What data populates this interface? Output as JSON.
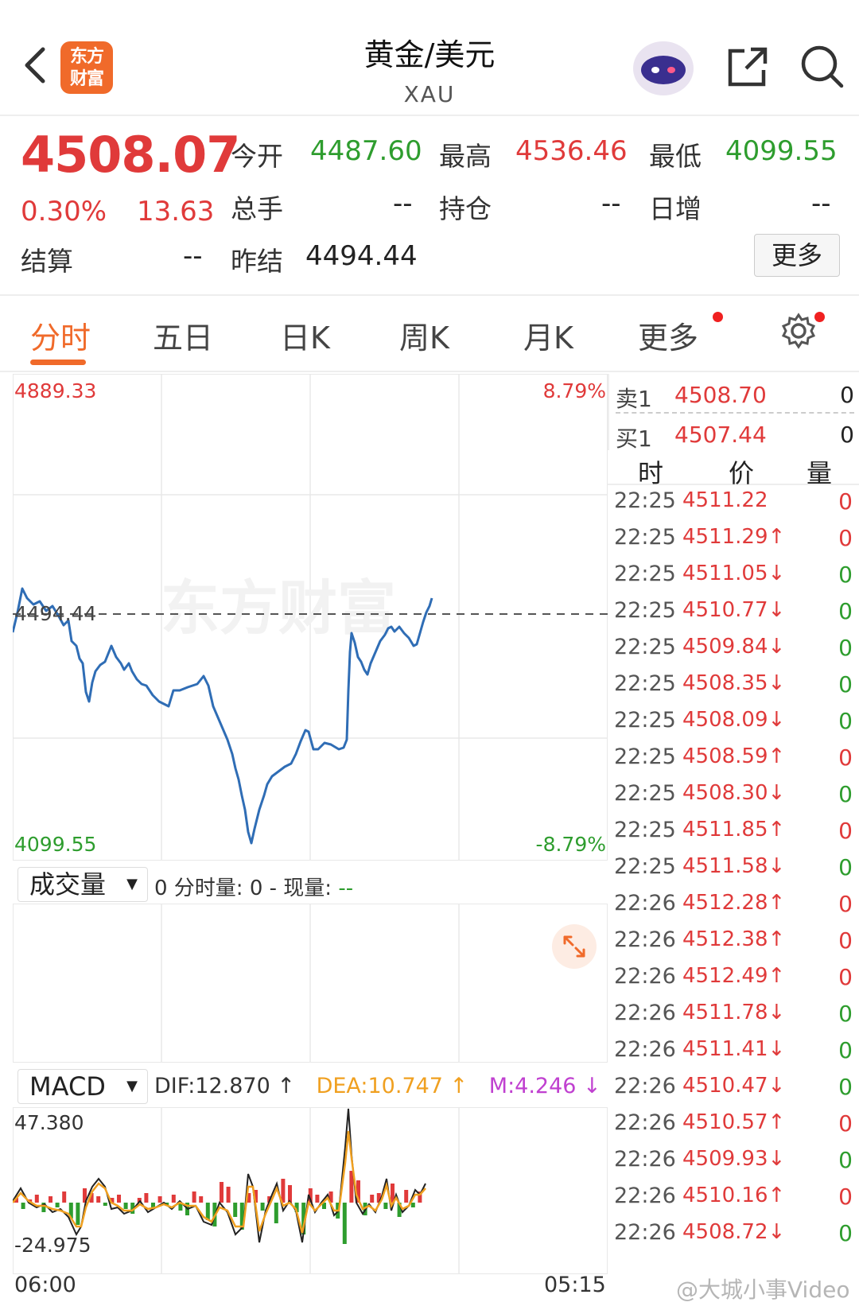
{
  "header": {
    "title": "黄金/美元",
    "subtitle": "XAU",
    "logo_text_1": "东方",
    "logo_text_2": "财富"
  },
  "quote": {
    "price": "4508.07",
    "change_pct": "0.30%",
    "change_abs": "13.63",
    "open_label": "今开",
    "open": "4487.60",
    "high_label": "最高",
    "high": "4536.46",
    "low_label": "最低",
    "low": "4099.55",
    "volume_label": "总手",
    "volume": "--",
    "position_label": "持仓",
    "position": "--",
    "daily_inc_label": "日增",
    "daily_inc": "--",
    "settle_label": "结算",
    "settle": "--",
    "prev_settle_label": "昨结",
    "prev_settle": "4494.44",
    "more_label": "更多"
  },
  "tabs": [
    "分时",
    "五日",
    "日K",
    "周K",
    "月K",
    "更多"
  ],
  "chart": {
    "y_max": "4889.33",
    "y_min": "4099.55",
    "pct_max": "8.79%",
    "pct_min": "-8.79%",
    "ref_line": "4494.44",
    "watermark": "东方财富",
    "x_start": "06:00",
    "x_end": "05:15"
  },
  "volume": {
    "select": "成交量",
    "info_a": "0 分时量: 0 - 现量: ",
    "info_b": "--"
  },
  "macd": {
    "select": "MACD",
    "dif": "DIF:12.870 ↑",
    "dea": "DEA:10.747 ↑",
    "m": "M:4.246 ↓",
    "y_max": "47.380",
    "y_min": "-24.975"
  },
  "order_book": {
    "sell_label": "卖1",
    "sell_price": "4508.70",
    "sell_qty": "0",
    "buy_label": "买1",
    "buy_price": "4507.44",
    "buy_qty": "0",
    "col_time": "时",
    "col_price": "价",
    "col_qty": "量"
  },
  "ticks": [
    {
      "t": "22:25",
      "p": "4511.22",
      "v": "0",
      "dir": "none"
    },
    {
      "t": "22:25",
      "p": "4511.29↑",
      "v": "0",
      "dir": "up"
    },
    {
      "t": "22:25",
      "p": "4511.05↓",
      "v": "0",
      "dir": "down"
    },
    {
      "t": "22:25",
      "p": "4510.77↓",
      "v": "0",
      "dir": "down"
    },
    {
      "t": "22:25",
      "p": "4509.84↓",
      "v": "0",
      "dir": "down"
    },
    {
      "t": "22:25",
      "p": "4508.35↓",
      "v": "0",
      "dir": "down"
    },
    {
      "t": "22:25",
      "p": "4508.09↓",
      "v": "0",
      "dir": "down"
    },
    {
      "t": "22:25",
      "p": "4508.59↑",
      "v": "0",
      "dir": "up"
    },
    {
      "t": "22:25",
      "p": "4508.30↓",
      "v": "0",
      "dir": "down"
    },
    {
      "t": "22:25",
      "p": "4511.85↑",
      "v": "0",
      "dir": "up"
    },
    {
      "t": "22:25",
      "p": "4511.58↓",
      "v": "0",
      "dir": "down"
    },
    {
      "t": "22:26",
      "p": "4512.28↑",
      "v": "0",
      "dir": "up"
    },
    {
      "t": "22:26",
      "p": "4512.38↑",
      "v": "0",
      "dir": "up"
    },
    {
      "t": "22:26",
      "p": "4512.49↑",
      "v": "0",
      "dir": "up"
    },
    {
      "t": "22:26",
      "p": "4511.78↓",
      "v": "0",
      "dir": "down"
    },
    {
      "t": "22:26",
      "p": "4511.41↓",
      "v": "0",
      "dir": "down"
    },
    {
      "t": "22:26",
      "p": "4510.47↓",
      "v": "0",
      "dir": "down"
    },
    {
      "t": "22:26",
      "p": "4510.57↑",
      "v": "0",
      "dir": "up"
    },
    {
      "t": "22:26",
      "p": "4509.93↓",
      "v": "0",
      "dir": "down"
    },
    {
      "t": "22:26",
      "p": "4510.16↑",
      "v": "0",
      "dir": "up"
    },
    {
      "t": "22:26",
      "p": "4508.72↓",
      "v": "0",
      "dir": "down"
    }
  ],
  "watermark_text": "@大城小事Video",
  "colors": {
    "up": "#e03a3a",
    "down": "#2e9d2e",
    "accent": "#f06a2a",
    "line": "#2f6db5"
  }
}
